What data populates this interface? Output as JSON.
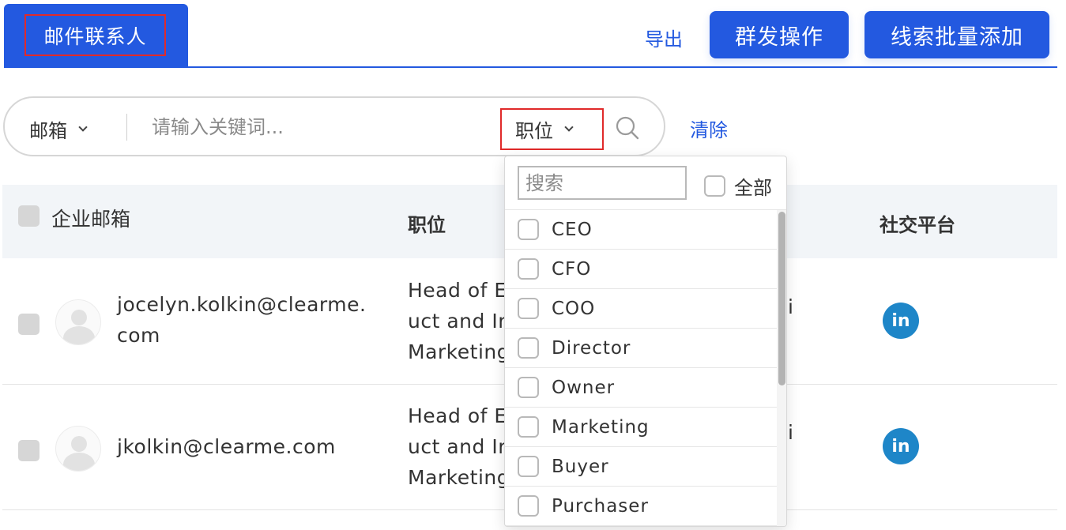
{
  "tabs": {
    "active_label": "邮件联系人"
  },
  "toolbar": {
    "export_label": "导出",
    "mass_action_label": "群发操作",
    "bulk_add_label": "线索批量添加"
  },
  "search": {
    "field_label": "邮箱",
    "placeholder": "请输入关键词...",
    "position_filter_label": "职位",
    "clear_label": "清除"
  },
  "table": {
    "headers": {
      "email": "企业邮箱",
      "position": "职位",
      "social": "社交平台"
    },
    "rows": [
      {
        "email_line1": "jocelyn.kolkin@clearme.",
        "email_line2": "com",
        "title_lines": [
          "Head of E",
          "uct and In",
          "Marketing"
        ],
        "hidden_col_fragment": "i",
        "social_icon": "linkedin-icon"
      },
      {
        "email_line1": "jkolkin@clearme.com",
        "title_lines": [
          "Head of E",
          "uct and In",
          "Marketing"
        ],
        "hidden_col_fragment": "i",
        "social_icon": "linkedin-icon"
      }
    ]
  },
  "dropdown": {
    "search_placeholder": "搜索",
    "all_label": "全部",
    "options": [
      "CEO",
      "CFO",
      "COO",
      "Director",
      "Owner",
      "Marketing",
      "Buyer",
      "Purchaser"
    ]
  },
  "colors": {
    "primary": "#2359e0",
    "highlight_border": "#e02a2a",
    "linkedin": "#1e86c8",
    "header_bg": "#f2f5f8"
  }
}
